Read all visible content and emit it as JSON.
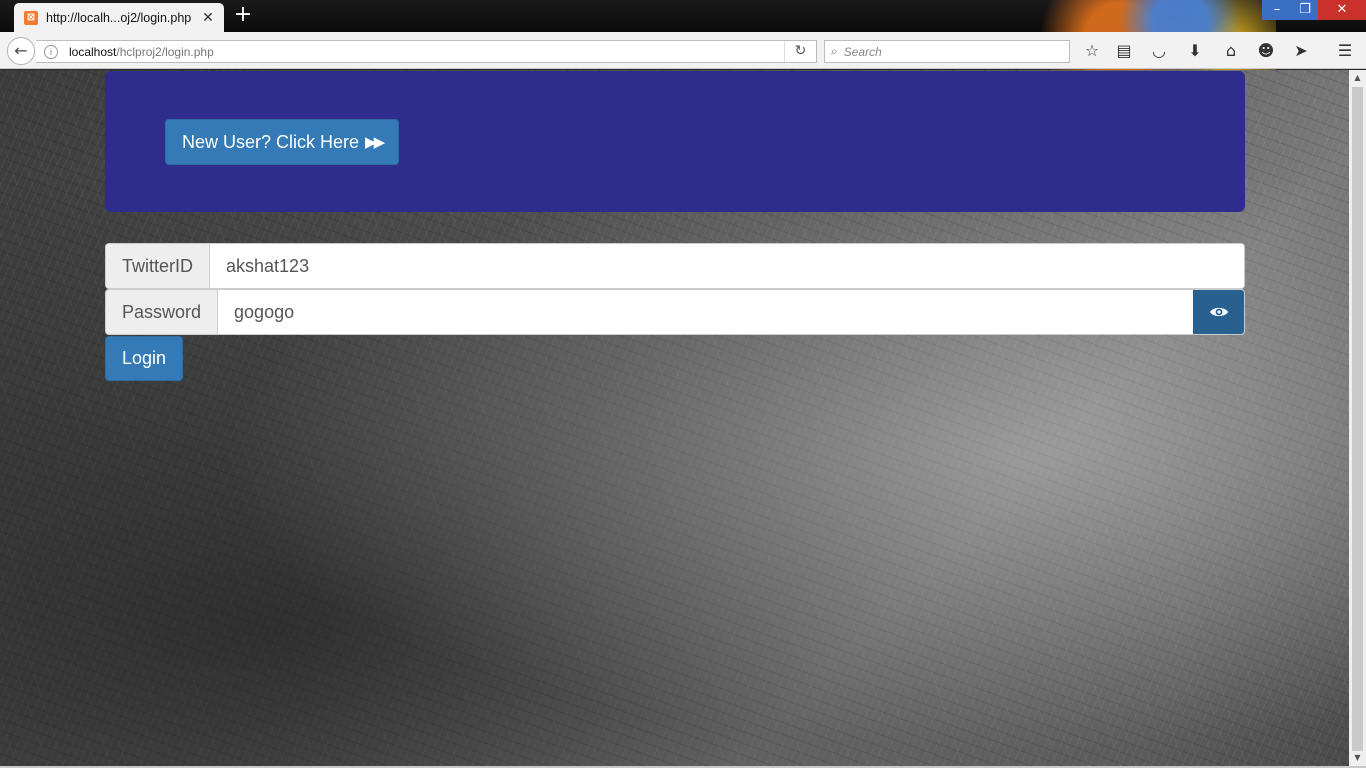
{
  "browser": {
    "tab_title": "http://localh...oj2/login.php",
    "favicon_letter": "⊠",
    "url_host": "localhost",
    "url_path": "/hclproj2/login.php",
    "search_placeholder": "Search"
  },
  "page": {
    "new_user_label": "New User? Click Here",
    "twitter_label": "TwitterID",
    "twitter_value": "akshat123",
    "password_label": "Password",
    "password_value": "gogogo",
    "login_label": "Login"
  },
  "colors": {
    "jumbotron": "#2e2d8c",
    "primary": "#337ab7",
    "eye_button": "#286090"
  }
}
